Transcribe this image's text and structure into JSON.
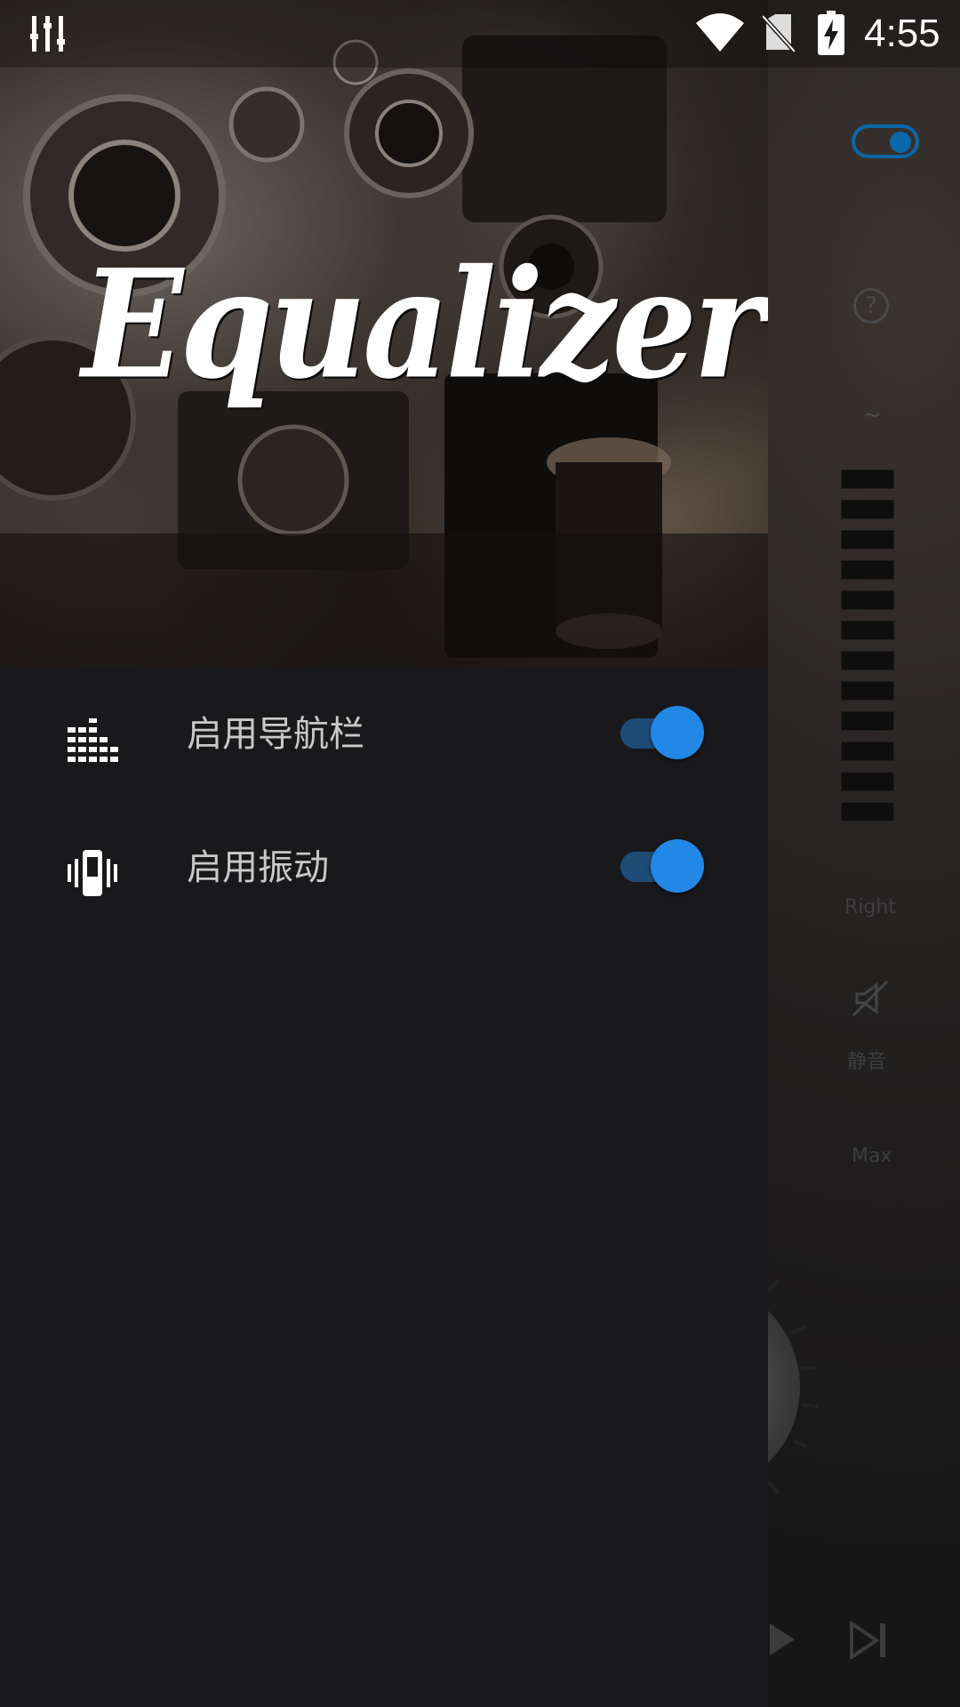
{
  "status_bar": {
    "time": "4:55",
    "icons": [
      "equalizer-icon",
      "wifi-icon",
      "no-sim-icon",
      "battery-charging-icon"
    ]
  },
  "drawer": {
    "header_title": "Equalizer",
    "menu_items": [
      {
        "icon": "equalizer-bars-icon",
        "label": "启用导航栏",
        "enabled": true
      },
      {
        "icon": "vibrate-icon",
        "label": "启用振动",
        "enabled": true
      }
    ]
  },
  "background_app": {
    "right_label": "Right",
    "mute_label": "静音",
    "max_label": "Max"
  },
  "colors": {
    "accent": "#2288e6",
    "switch_track": "#1f4b77",
    "drawer_background": "#19191c"
  }
}
